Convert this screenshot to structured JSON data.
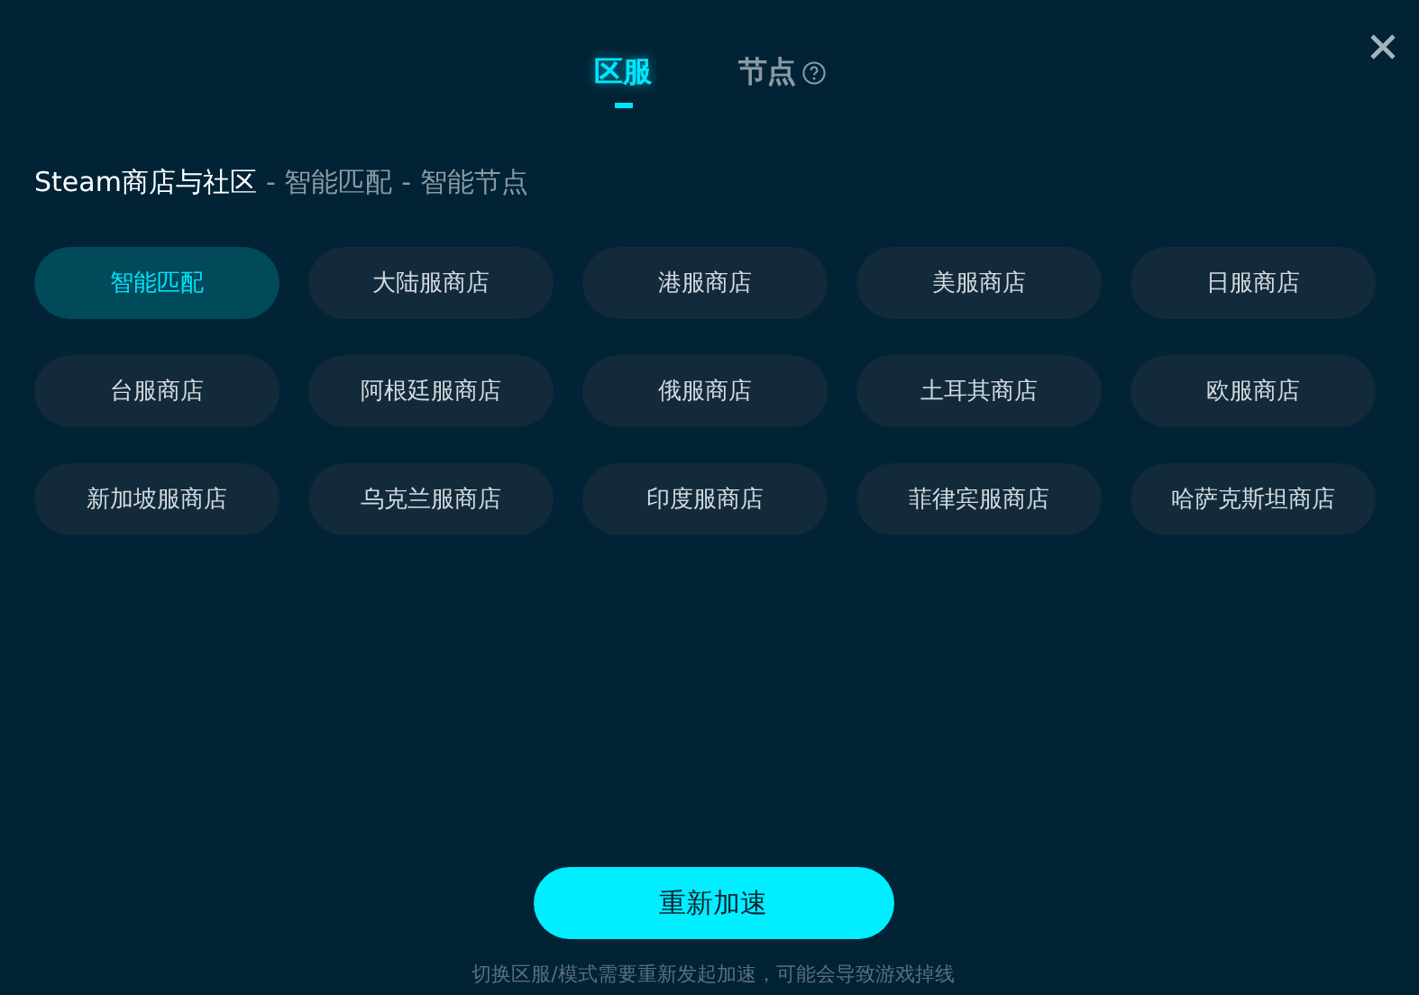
{
  "tabs": [
    {
      "label": "区服",
      "selected": true,
      "help": false
    },
    {
      "label": "节点",
      "selected": false,
      "help": true
    }
  ],
  "breadcrumb": {
    "game": "Steam商店与社区",
    "parts": [
      "- 智能匹配",
      "- 智能节点"
    ]
  },
  "regions": [
    {
      "label": "智能匹配",
      "selected": true
    },
    {
      "label": "大陆服商店",
      "selected": false
    },
    {
      "label": "港服商店",
      "selected": false
    },
    {
      "label": "美服商店",
      "selected": false
    },
    {
      "label": "日服商店",
      "selected": false
    },
    {
      "label": "台服商店",
      "selected": false
    },
    {
      "label": "阿根廷服商店",
      "selected": false
    },
    {
      "label": "俄服商店",
      "selected": false
    },
    {
      "label": "土耳其商店",
      "selected": false
    },
    {
      "label": "欧服商店",
      "selected": false
    },
    {
      "label": "新加坡服商店",
      "selected": false
    },
    {
      "label": "乌克兰服商店",
      "selected": false
    },
    {
      "label": "印度服商店",
      "selected": false
    },
    {
      "label": "菲律宾服商店",
      "selected": false
    },
    {
      "label": "哈萨克斯坦商店",
      "selected": false
    }
  ],
  "action_button": "重新加速",
  "note": "切换区服/模式需要重新发起加速，可能会导致游戏掉线"
}
